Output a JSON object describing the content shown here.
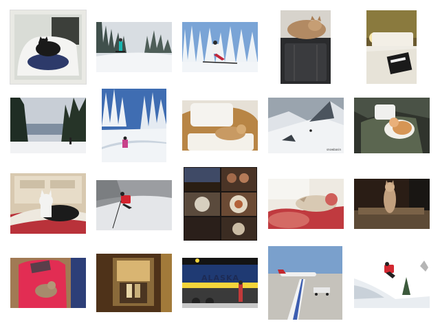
{
  "photos": [
    {
      "id": "cat-white-chair",
      "label": ""
    },
    {
      "id": "snowboarder-teal",
      "label": ""
    },
    {
      "id": "skier-snow-trees",
      "label": ""
    },
    {
      "id": "cat-on-suitcase",
      "label": ""
    },
    {
      "id": "hotel-bed",
      "label": ""
    },
    {
      "id": "forest-lake",
      "label": ""
    },
    {
      "id": "skier-pink-slope",
      "label": ""
    },
    {
      "id": "cat-armchair",
      "label": ""
    },
    {
      "id": "mountain-skier",
      "label": "snowbasin"
    },
    {
      "id": "cat-in-bag",
      "label": ""
    },
    {
      "id": "cat-dresser-bed",
      "label": ""
    },
    {
      "id": "skier-red-jacket",
      "label": ""
    },
    {
      "id": "food-collage",
      "label": ""
    },
    {
      "id": "cat-floral-sofa",
      "label": ""
    },
    {
      "id": "cat-on-stool",
      "label": ""
    },
    {
      "id": "cat-red-chair",
      "label": ""
    },
    {
      "id": "bar-doorway",
      "label": ""
    },
    {
      "id": "alaska-train",
      "label": "ALASKA"
    },
    {
      "id": "airplane-runway",
      "label": ""
    },
    {
      "id": "snowboarder-jump",
      "label": ""
    }
  ]
}
